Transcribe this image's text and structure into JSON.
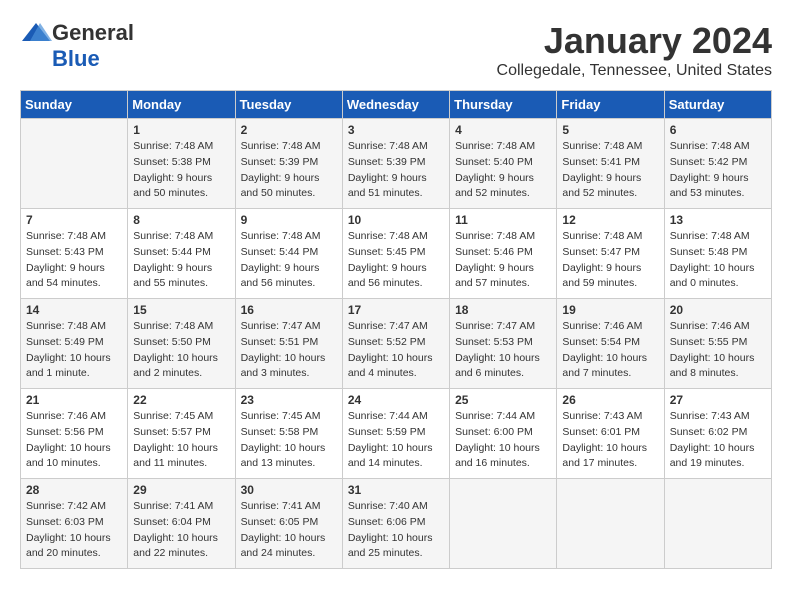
{
  "header": {
    "logo_general": "General",
    "logo_blue": "Blue",
    "month_title": "January 2024",
    "location": "Collegedale, Tennessee, United States"
  },
  "days_of_week": [
    "Sunday",
    "Monday",
    "Tuesday",
    "Wednesday",
    "Thursday",
    "Friday",
    "Saturday"
  ],
  "weeks": [
    [
      {
        "day": "",
        "sunrise": "",
        "sunset": "",
        "daylight": ""
      },
      {
        "day": "1",
        "sunrise": "Sunrise: 7:48 AM",
        "sunset": "Sunset: 5:38 PM",
        "daylight": "Daylight: 9 hours and 50 minutes."
      },
      {
        "day": "2",
        "sunrise": "Sunrise: 7:48 AM",
        "sunset": "Sunset: 5:39 PM",
        "daylight": "Daylight: 9 hours and 50 minutes."
      },
      {
        "day": "3",
        "sunrise": "Sunrise: 7:48 AM",
        "sunset": "Sunset: 5:39 PM",
        "daylight": "Daylight: 9 hours and 51 minutes."
      },
      {
        "day": "4",
        "sunrise": "Sunrise: 7:48 AM",
        "sunset": "Sunset: 5:40 PM",
        "daylight": "Daylight: 9 hours and 52 minutes."
      },
      {
        "day": "5",
        "sunrise": "Sunrise: 7:48 AM",
        "sunset": "Sunset: 5:41 PM",
        "daylight": "Daylight: 9 hours and 52 minutes."
      },
      {
        "day": "6",
        "sunrise": "Sunrise: 7:48 AM",
        "sunset": "Sunset: 5:42 PM",
        "daylight": "Daylight: 9 hours and 53 minutes."
      }
    ],
    [
      {
        "day": "7",
        "sunrise": "Sunrise: 7:48 AM",
        "sunset": "Sunset: 5:43 PM",
        "daylight": "Daylight: 9 hours and 54 minutes."
      },
      {
        "day": "8",
        "sunrise": "Sunrise: 7:48 AM",
        "sunset": "Sunset: 5:44 PM",
        "daylight": "Daylight: 9 hours and 55 minutes."
      },
      {
        "day": "9",
        "sunrise": "Sunrise: 7:48 AM",
        "sunset": "Sunset: 5:44 PM",
        "daylight": "Daylight: 9 hours and 56 minutes."
      },
      {
        "day": "10",
        "sunrise": "Sunrise: 7:48 AM",
        "sunset": "Sunset: 5:45 PM",
        "daylight": "Daylight: 9 hours and 56 minutes."
      },
      {
        "day": "11",
        "sunrise": "Sunrise: 7:48 AM",
        "sunset": "Sunset: 5:46 PM",
        "daylight": "Daylight: 9 hours and 57 minutes."
      },
      {
        "day": "12",
        "sunrise": "Sunrise: 7:48 AM",
        "sunset": "Sunset: 5:47 PM",
        "daylight": "Daylight: 9 hours and 59 minutes."
      },
      {
        "day": "13",
        "sunrise": "Sunrise: 7:48 AM",
        "sunset": "Sunset: 5:48 PM",
        "daylight": "Daylight: 10 hours and 0 minutes."
      }
    ],
    [
      {
        "day": "14",
        "sunrise": "Sunrise: 7:48 AM",
        "sunset": "Sunset: 5:49 PM",
        "daylight": "Daylight: 10 hours and 1 minute."
      },
      {
        "day": "15",
        "sunrise": "Sunrise: 7:48 AM",
        "sunset": "Sunset: 5:50 PM",
        "daylight": "Daylight: 10 hours and 2 minutes."
      },
      {
        "day": "16",
        "sunrise": "Sunrise: 7:47 AM",
        "sunset": "Sunset: 5:51 PM",
        "daylight": "Daylight: 10 hours and 3 minutes."
      },
      {
        "day": "17",
        "sunrise": "Sunrise: 7:47 AM",
        "sunset": "Sunset: 5:52 PM",
        "daylight": "Daylight: 10 hours and 4 minutes."
      },
      {
        "day": "18",
        "sunrise": "Sunrise: 7:47 AM",
        "sunset": "Sunset: 5:53 PM",
        "daylight": "Daylight: 10 hours and 6 minutes."
      },
      {
        "day": "19",
        "sunrise": "Sunrise: 7:46 AM",
        "sunset": "Sunset: 5:54 PM",
        "daylight": "Daylight: 10 hours and 7 minutes."
      },
      {
        "day": "20",
        "sunrise": "Sunrise: 7:46 AM",
        "sunset": "Sunset: 5:55 PM",
        "daylight": "Daylight: 10 hours and 8 minutes."
      }
    ],
    [
      {
        "day": "21",
        "sunrise": "Sunrise: 7:46 AM",
        "sunset": "Sunset: 5:56 PM",
        "daylight": "Daylight: 10 hours and 10 minutes."
      },
      {
        "day": "22",
        "sunrise": "Sunrise: 7:45 AM",
        "sunset": "Sunset: 5:57 PM",
        "daylight": "Daylight: 10 hours and 11 minutes."
      },
      {
        "day": "23",
        "sunrise": "Sunrise: 7:45 AM",
        "sunset": "Sunset: 5:58 PM",
        "daylight": "Daylight: 10 hours and 13 minutes."
      },
      {
        "day": "24",
        "sunrise": "Sunrise: 7:44 AM",
        "sunset": "Sunset: 5:59 PM",
        "daylight": "Daylight: 10 hours and 14 minutes."
      },
      {
        "day": "25",
        "sunrise": "Sunrise: 7:44 AM",
        "sunset": "Sunset: 6:00 PM",
        "daylight": "Daylight: 10 hours and 16 minutes."
      },
      {
        "day": "26",
        "sunrise": "Sunrise: 7:43 AM",
        "sunset": "Sunset: 6:01 PM",
        "daylight": "Daylight: 10 hours and 17 minutes."
      },
      {
        "day": "27",
        "sunrise": "Sunrise: 7:43 AM",
        "sunset": "Sunset: 6:02 PM",
        "daylight": "Daylight: 10 hours and 19 minutes."
      }
    ],
    [
      {
        "day": "28",
        "sunrise": "Sunrise: 7:42 AM",
        "sunset": "Sunset: 6:03 PM",
        "daylight": "Daylight: 10 hours and 20 minutes."
      },
      {
        "day": "29",
        "sunrise": "Sunrise: 7:41 AM",
        "sunset": "Sunset: 6:04 PM",
        "daylight": "Daylight: 10 hours and 22 minutes."
      },
      {
        "day": "30",
        "sunrise": "Sunrise: 7:41 AM",
        "sunset": "Sunset: 6:05 PM",
        "daylight": "Daylight: 10 hours and 24 minutes."
      },
      {
        "day": "31",
        "sunrise": "Sunrise: 7:40 AM",
        "sunset": "Sunset: 6:06 PM",
        "daylight": "Daylight: 10 hours and 25 minutes."
      },
      {
        "day": "",
        "sunrise": "",
        "sunset": "",
        "daylight": ""
      },
      {
        "day": "",
        "sunrise": "",
        "sunset": "",
        "daylight": ""
      },
      {
        "day": "",
        "sunrise": "",
        "sunset": "",
        "daylight": ""
      }
    ]
  ]
}
